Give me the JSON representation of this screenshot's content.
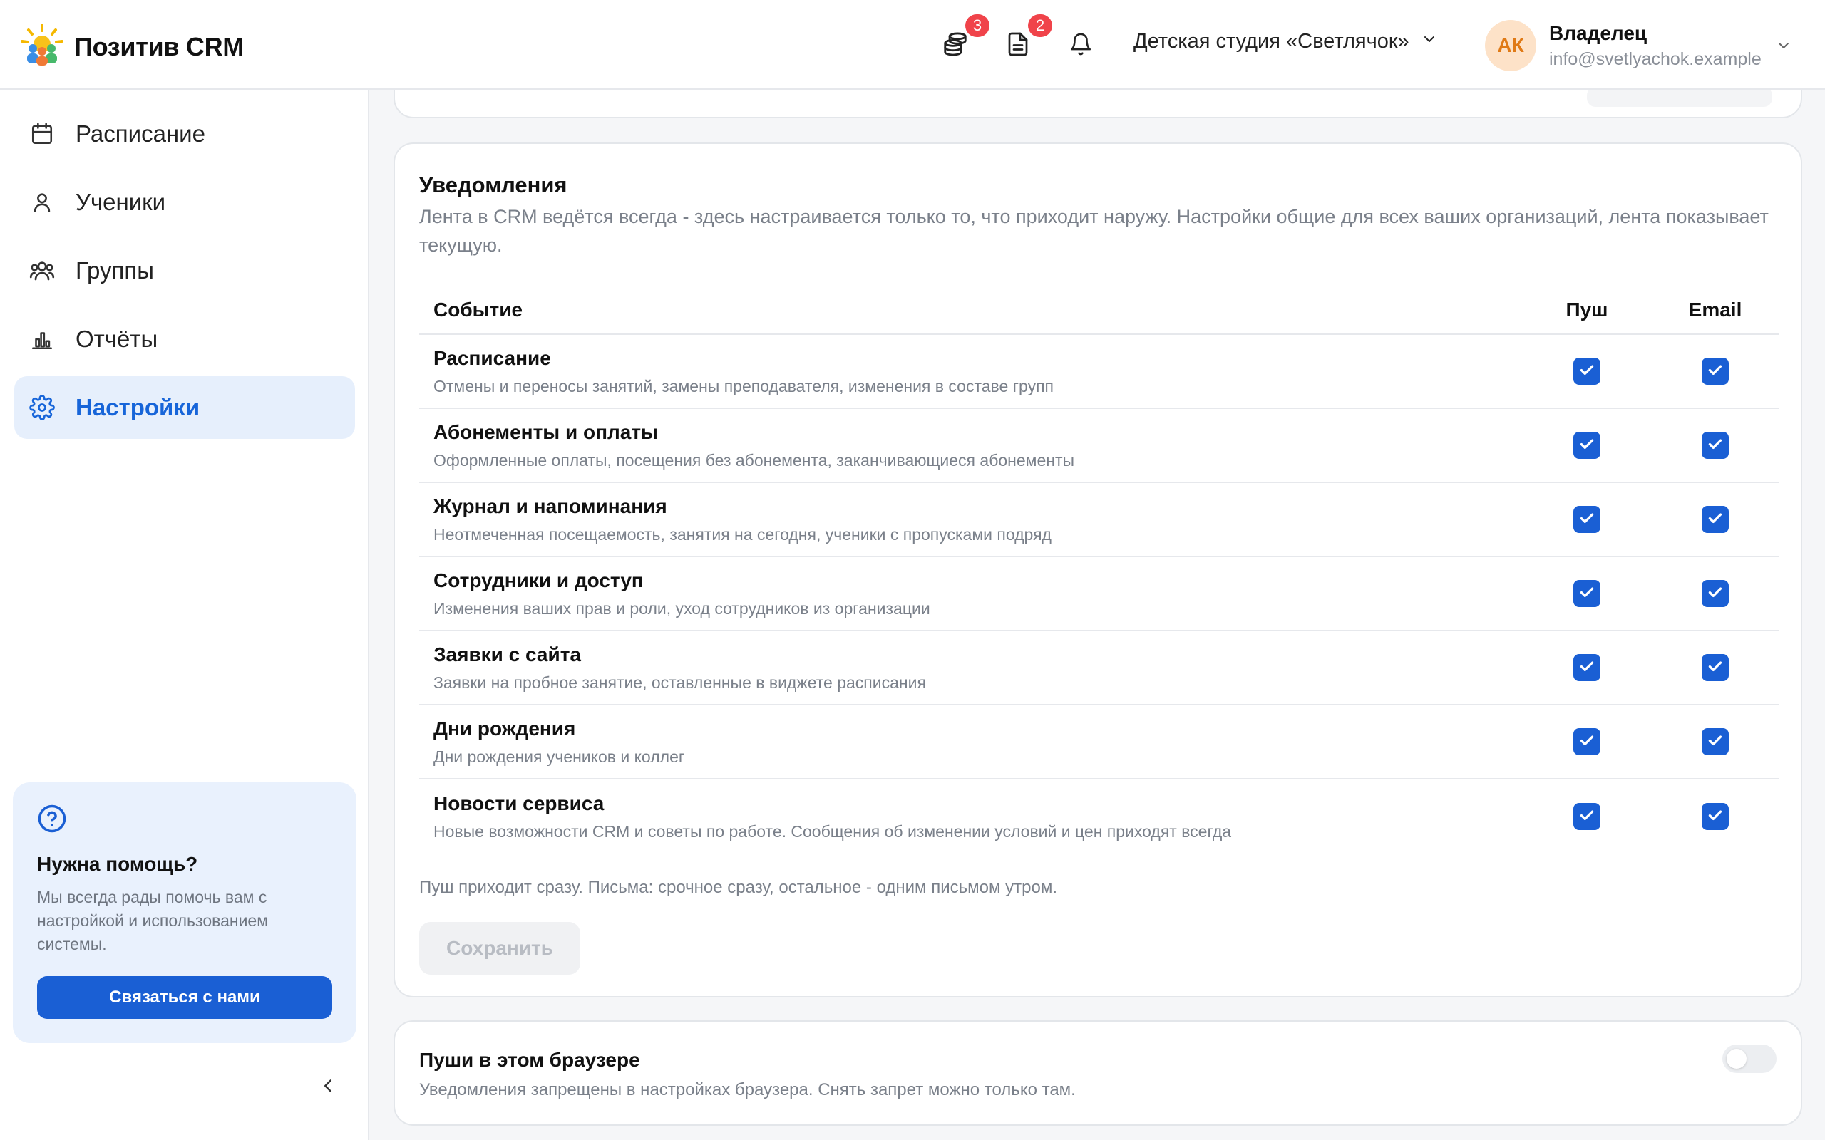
{
  "app": {
    "name": "Позитив CRM",
    "brand_color": "#1a5fd4"
  },
  "header": {
    "icons": [
      {
        "name": "payments-icon",
        "badge": "3"
      },
      {
        "name": "document-icon",
        "badge": "2"
      },
      {
        "name": "bell-icon",
        "badge": ""
      }
    ],
    "organization": "Детская студия «Светлячок»",
    "user": {
      "initials": "АК",
      "role": "Владелец",
      "email": "info@svetlyachok.example"
    }
  },
  "sidebar": {
    "items": [
      {
        "label": "Расписание",
        "icon": "calendar-icon",
        "active": false
      },
      {
        "label": "Ученики",
        "icon": "user-icon",
        "active": false
      },
      {
        "label": "Группы",
        "icon": "users-icon",
        "active": false
      },
      {
        "label": "Отчёты",
        "icon": "chart-icon",
        "active": false
      },
      {
        "label": "Настройки",
        "icon": "gear-icon",
        "active": true
      }
    ],
    "help": {
      "title": "Нужна помощь?",
      "text": "Мы всегда рады помочь вам с настройкой и использованием системы.",
      "button": "Связаться с нами"
    }
  },
  "notifications": {
    "title": "Уведомления",
    "description": "Лента в CRM ведётся всегда - здесь настраивается только то, что приходит наружу. Настройки общие для всех ваших организаций, лента показывает текущую.",
    "columns": {
      "event": "Событие",
      "push": "Пуш",
      "email": "Email"
    },
    "rows": [
      {
        "title": "Расписание",
        "desc": "Отмены и переносы занятий, замены преподавателя, изменения в составе групп",
        "push": true,
        "email": true
      },
      {
        "title": "Абонементы и оплаты",
        "desc": "Оформленные оплаты, посещения без абонемента, заканчивающиеся абонементы",
        "push": true,
        "email": true
      },
      {
        "title": "Журнал и напоминания",
        "desc": "Неотмеченная посещаемость, занятия на сегодня, ученики с пропусками подряд",
        "push": true,
        "email": true
      },
      {
        "title": "Сотрудники и доступ",
        "desc": "Изменения ваших прав и роли, уход сотрудников из организации",
        "push": true,
        "email": true
      },
      {
        "title": "Заявки с сайта",
        "desc": "Заявки на пробное занятие, оставленные в виджете расписания",
        "push": true,
        "email": true
      },
      {
        "title": "Дни рождения",
        "desc": "Дни рождения учеников и коллег",
        "push": true,
        "email": true
      },
      {
        "title": "Новости сервиса",
        "desc": "Новые возможности CRM и советы по работе. Сообщения об изменении условий и цен приходят всегда",
        "push": true,
        "email": true
      }
    ],
    "footnote": "Пуш приходит сразу. Письма: срочное сразу, остальное - одним письмом утром.",
    "save_label": "Сохранить"
  },
  "browser_push": {
    "title": "Пуши в этом браузере",
    "description": "Уведомления запрещены в настройках браузера. Снять запрет можно только там.",
    "enabled": false
  }
}
